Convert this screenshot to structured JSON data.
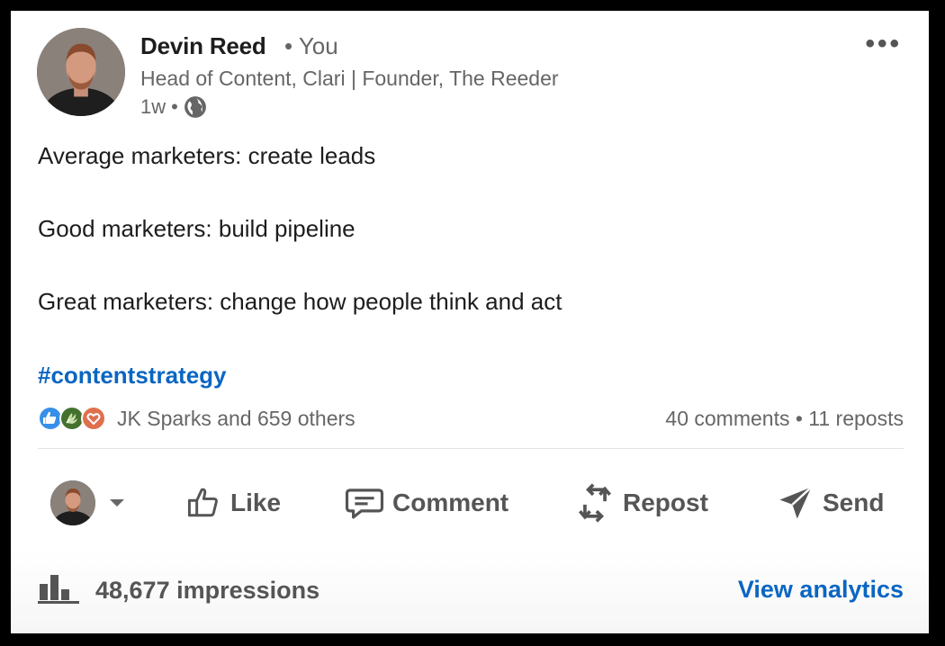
{
  "post": {
    "author": {
      "name": "Devin Reed",
      "relation": "• You",
      "headline": "Head of Content, Clari | Founder, The Reeder",
      "time": "1w",
      "dot": "•",
      "visibility_icon": "globe-icon"
    },
    "menu_icon": "more-options-icon",
    "lines": [
      "Average marketers: create leads",
      "Good marketers: build pipeline",
      "Great marketers: change how people think and act"
    ],
    "hashtag": "#contentstrategy"
  },
  "social": {
    "reaction_icons": [
      "like-reaction-icon",
      "celebrate-reaction-icon",
      "love-reaction-icon"
    ],
    "reactions_text": "JK Sparks and 659 others",
    "counts_text": "40 comments • 11 reposts"
  },
  "actions": {
    "like": "Like",
    "comment": "Comment",
    "repost": "Repost",
    "send": "Send"
  },
  "stats": {
    "impressions": "48,677 impressions",
    "view_analytics": "View analytics"
  },
  "colors": {
    "link": "#0a66c2",
    "text_primary": "#1d1d1d",
    "text_secondary": "#666666",
    "like_reaction": "#378fe9",
    "celebrate_reaction": "#44712e",
    "love_reaction": "#df704d"
  }
}
